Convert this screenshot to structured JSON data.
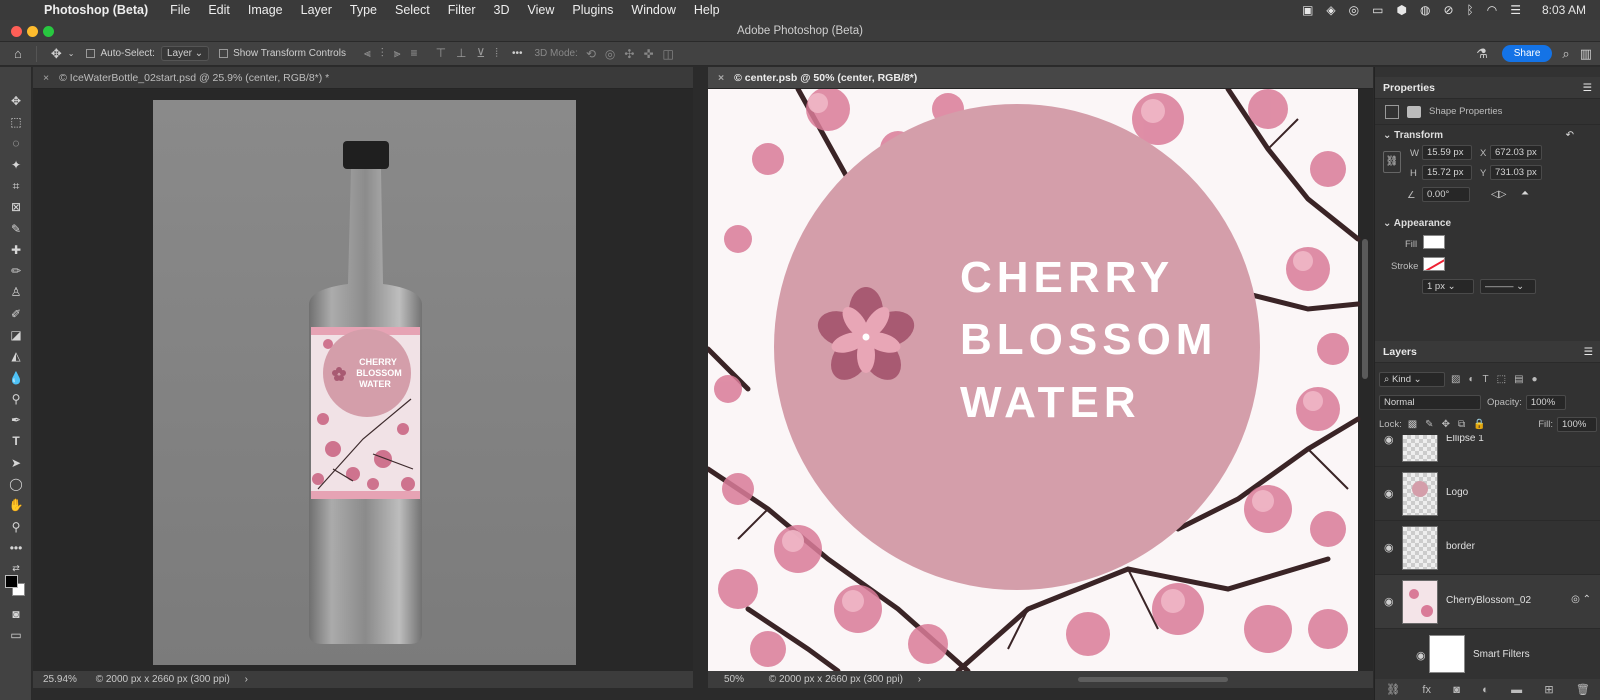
{
  "menubar": {
    "apple_glyph": "",
    "app_name": "Photoshop (Beta)",
    "items": [
      "File",
      "Edit",
      "Image",
      "Layer",
      "Type",
      "Select",
      "Filter",
      "3D",
      "View",
      "Plugins",
      "Window",
      "Help"
    ],
    "time": "8:03 AM"
  },
  "window": {
    "title": "Adobe Photoshop (Beta)"
  },
  "options": {
    "auto_select_label": "Auto-Select:",
    "auto_select_value": "Layer",
    "transform_label": "Show Transform Controls",
    "mode_label": "3D Mode:",
    "share_label": "Share"
  },
  "documents": {
    "left_tab": "© IceWaterBottle_02start.psd @ 25.9% (center, RGB/8*) *",
    "right_tab": "© center.psb @ 50% (center, RGB/8*)",
    "left_zoom": "25.94%",
    "left_info": "© 2000 px x 2660 px (300 ppi)",
    "right_zoom": "50%",
    "right_info": "© 2000 px x 2660 px (300 ppi)"
  },
  "label_art": {
    "line1": "CHERRY",
    "line2": "BLOSSOM",
    "line3": "WATER"
  },
  "properties": {
    "title": "Properties",
    "shape_label": "Shape Properties",
    "transform_heading": "Transform",
    "w_label": "W",
    "w_value": "15.59 px",
    "x_label": "X",
    "x_value": "672.03 px",
    "h_label": "H",
    "h_value": "15.72 px",
    "y_label": "Y",
    "y_value": "731.03 px",
    "angle_value": "0.00°",
    "appearance_heading": "Appearance",
    "fill_label": "Fill",
    "stroke_label": "Stroke",
    "stroke_width": "1 px"
  },
  "layers": {
    "title": "Layers",
    "kind_label": "Kind",
    "blend_mode": "Normal",
    "opacity_label": "Opacity:",
    "opacity_value": "100%",
    "lock_label": "Lock:",
    "fill_label": "Fill:",
    "fill_value": "100%",
    "items": [
      {
        "name": "Ellipse 1"
      },
      {
        "name": "Logo"
      },
      {
        "name": "border"
      },
      {
        "name": "CherryBlossom_02"
      },
      {
        "name": "Smart Filters"
      }
    ]
  },
  "colors": {
    "accent": "#1473e6",
    "circle_pink": "#d49eaa",
    "flower_dark": "#a85a72",
    "flower_light": "#e8a6b6"
  }
}
